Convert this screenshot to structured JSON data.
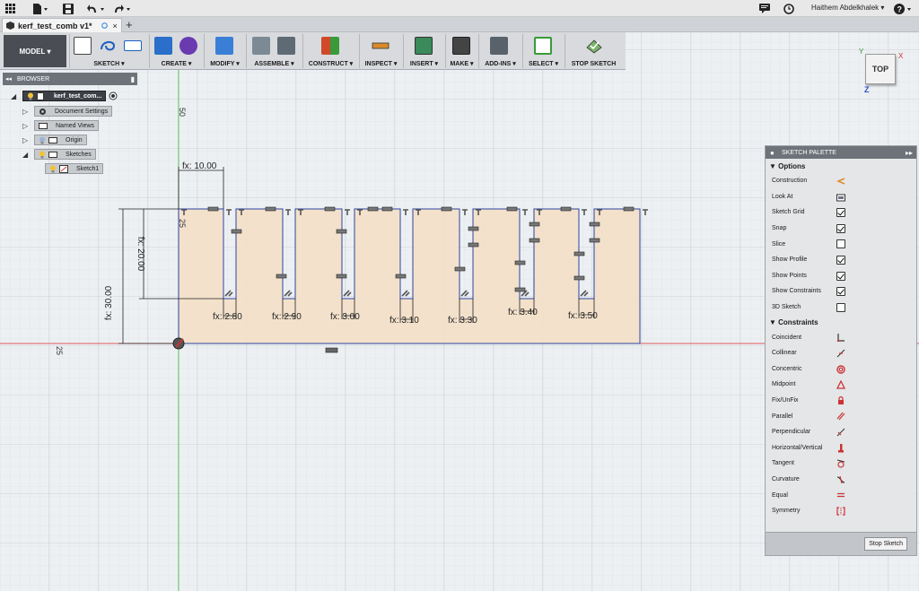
{
  "topbar": {
    "user_name": "Haithem Abdelkhalek",
    "help_label": "?"
  },
  "tabbar": {
    "doc_tab_label": "kerf_test_comb v1*",
    "new_tab_label": "+"
  },
  "toolbar": {
    "model_label": "MODEL ▾",
    "groups": [
      {
        "label": "SKETCH ▾"
      },
      {
        "label": "CREATE ▾"
      },
      {
        "label": "MODIFY ▾"
      },
      {
        "label": "ASSEMBLE ▾"
      },
      {
        "label": "CONSTRUCT ▾"
      },
      {
        "label": "INSPECT ▾"
      },
      {
        "label": "INSERT ▾"
      },
      {
        "label": "MAKE ▾"
      },
      {
        "label": "ADD-INS ▾"
      },
      {
        "label": "SELECT ▾"
      },
      {
        "label": "STOP SKETCH"
      }
    ]
  },
  "browser": {
    "title": "BROWSER",
    "root_label": "kerf_test_com...",
    "items": [
      {
        "label": "Document Settings"
      },
      {
        "label": "Named Views"
      },
      {
        "label": "Origin"
      },
      {
        "label": "Sketches"
      },
      {
        "label": "Sketch1"
      }
    ]
  },
  "viewcube": {
    "label": "TOP",
    "axis_x": "X",
    "axis_y": "Y",
    "axis_z": "Z"
  },
  "canvas": {
    "ruler_top": "50",
    "ruler_left": "25",
    "ruler_mid": "25",
    "dims": {
      "width": "fx: 10.00",
      "height_inner": "fx: 20.00",
      "height_outer": "fx: 30.00",
      "slots": [
        "fx: 2.80",
        "fx: 2.90",
        "fx: 3.00",
        "fx: 3.10",
        "fx: 3.30",
        "fx: 3.40",
        "fx: 3.50"
      ]
    }
  },
  "palette": {
    "title": "SKETCH PALETTE",
    "options_label": "▼ Options",
    "options": [
      {
        "label": "Construction"
      },
      {
        "label": "Look At"
      },
      {
        "label": "Sketch Grid"
      },
      {
        "label": "Snap"
      },
      {
        "label": "Slice"
      },
      {
        "label": "Show Profile"
      },
      {
        "label": "Show Points"
      },
      {
        "label": "Show Constraints"
      },
      {
        "label": "3D Sketch"
      }
    ],
    "constraints_label": "▼ Constraints",
    "constraints": [
      {
        "label": "Coincident"
      },
      {
        "label": "Collinear"
      },
      {
        "label": "Concentric"
      },
      {
        "label": "Midpoint"
      },
      {
        "label": "Fix/UnFix"
      },
      {
        "label": "Parallel"
      },
      {
        "label": "Perpendicular"
      },
      {
        "label": "Horizontal/Vertical"
      },
      {
        "label": "Tangent"
      },
      {
        "label": "Curvature"
      },
      {
        "label": "Equal"
      },
      {
        "label": "Symmetry"
      }
    ],
    "stop_sketch_label": "Stop Sketch"
  }
}
